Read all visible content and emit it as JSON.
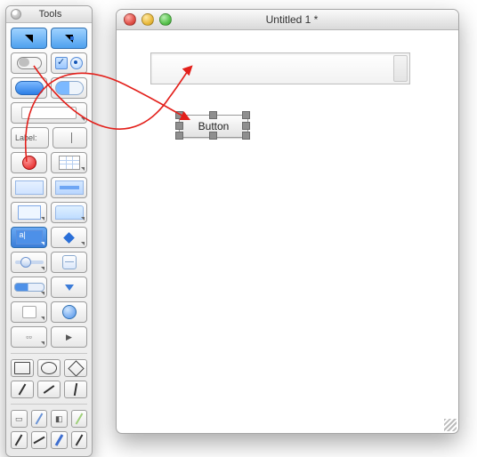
{
  "tools_palette": {
    "title": "Tools",
    "label_tool_text": "Label:"
  },
  "document": {
    "title": "Untitled 1 *"
  },
  "canvas": {
    "button_label": "Button"
  },
  "annotation": {
    "color": "#e3201b"
  }
}
